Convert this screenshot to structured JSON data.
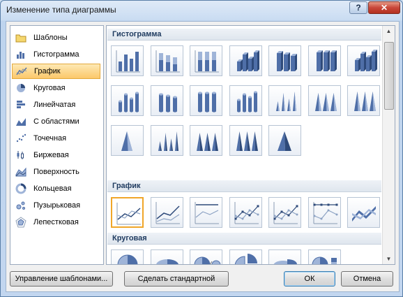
{
  "window": {
    "title": "Изменение типа диаграммы",
    "help_label": "?",
    "close_label": "✕"
  },
  "categories": [
    {
      "label": "Шаблоны",
      "icon": "folder-icon",
      "selected": false
    },
    {
      "label": "Гистограмма",
      "icon": "column-chart-icon",
      "selected": false
    },
    {
      "label": "График",
      "icon": "line-chart-icon",
      "selected": true
    },
    {
      "label": "Круговая",
      "icon": "pie-chart-icon",
      "selected": false
    },
    {
      "label": "Линейчатая",
      "icon": "bar-chart-icon",
      "selected": false
    },
    {
      "label": "С областями",
      "icon": "area-chart-icon",
      "selected": false
    },
    {
      "label": "Точечная",
      "icon": "scatter-chart-icon",
      "selected": false
    },
    {
      "label": "Биржевая",
      "icon": "stock-chart-icon",
      "selected": false
    },
    {
      "label": "Поверхность",
      "icon": "surface-chart-icon",
      "selected": false
    },
    {
      "label": "Кольцевая",
      "icon": "doughnut-chart-icon",
      "selected": false
    },
    {
      "label": "Пузырьковая",
      "icon": "bubble-chart-icon",
      "selected": false
    },
    {
      "label": "Лепестковая",
      "icon": "radar-chart-icon",
      "selected": false
    }
  ],
  "sections": [
    {
      "title": "Гистограмма",
      "thumbs": [
        "clustered-column",
        "stacked-column",
        "percent-column",
        "3d-clustered-column",
        "3d-stacked-column",
        "3d-percent-column",
        "3d-column",
        "clustered-cylinder",
        "stacked-cylinder",
        "percent-cylinder",
        "3d-cylinder",
        "clustered-cone",
        "stacked-cone",
        "percent-cone",
        "3d-cone",
        "clustered-pyramid",
        "stacked-pyramid",
        "percent-pyramid",
        "3d-pyramid"
      ]
    },
    {
      "title": "График",
      "thumbs": [
        "line",
        "stacked-line",
        "percent-line",
        "line-markers",
        "stacked-line-markers",
        "percent-line-markers",
        "3d-line"
      ],
      "selected_index": 0
    },
    {
      "title": "Круговая",
      "thumbs": [
        "pie",
        "3d-pie",
        "pie-of-pie",
        "exploded-pie",
        "3d-exploded-pie",
        "bar-of-pie"
      ]
    }
  ],
  "footer": {
    "manage_templates_label": "Управление шаблонами...",
    "set_default_label": "Сделать стандартной",
    "ok_label": "ОК",
    "cancel_label": "Отмена"
  },
  "colors": {
    "accent": "#f0a629",
    "chart_blue": "#4f6fa8"
  }
}
